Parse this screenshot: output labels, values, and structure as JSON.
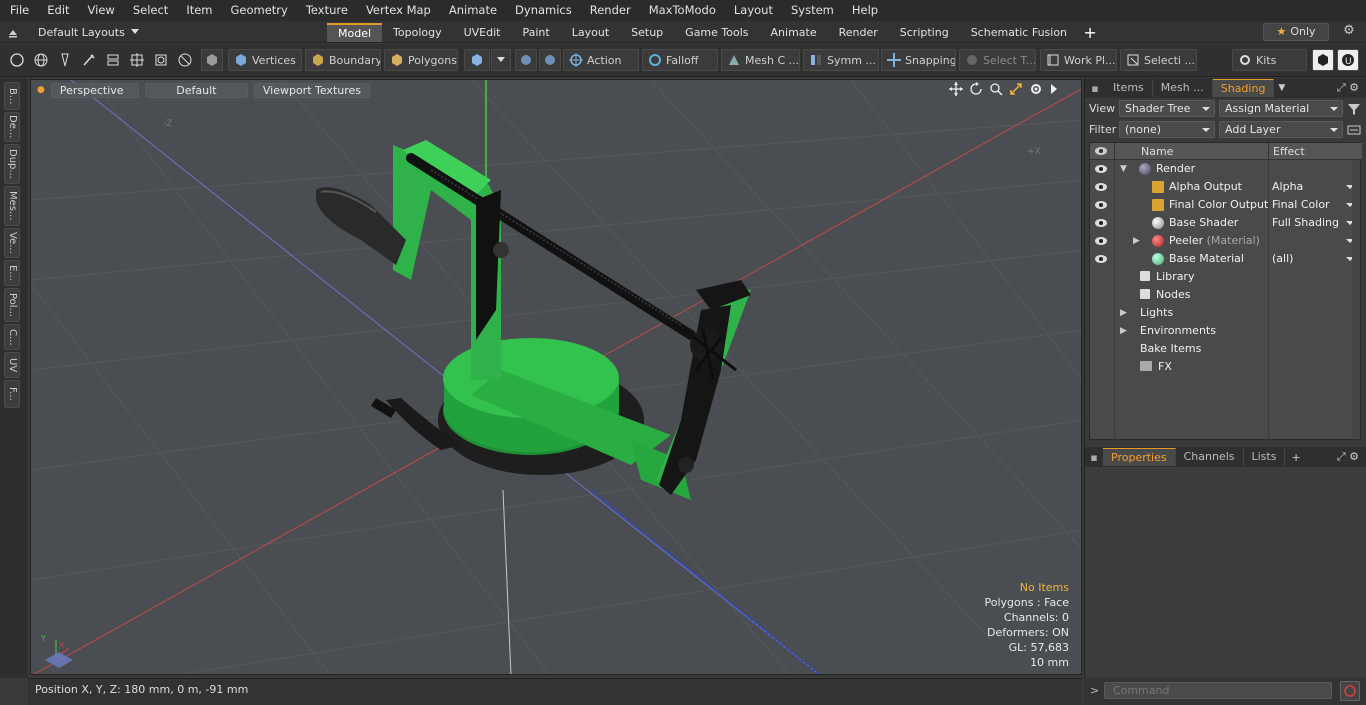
{
  "menubar": [
    "File",
    "Edit",
    "View",
    "Select",
    "Item",
    "Geometry",
    "Texture",
    "Vertex Map",
    "Animate",
    "Dynamics",
    "Render",
    "MaxToModo",
    "Layout",
    "System",
    "Help"
  ],
  "layouts": {
    "label": "Default Layouts"
  },
  "tabs": [
    "Model",
    "Topology",
    "UVEdit",
    "Paint",
    "Layout",
    "Setup",
    "Game Tools",
    "Animate",
    "Render",
    "Scripting",
    "Schematic Fusion"
  ],
  "active_tab": "Model",
  "only_button": "Only",
  "toolbar": {
    "vertices": "Vertices",
    "boundary": "Boundary",
    "polygons": "Polygons",
    "action": "Action",
    "falloff": "Falloff",
    "mesh": "Mesh C ...",
    "symm": "Symm ...",
    "snapping": "Snapping",
    "select_t": "Select T...",
    "work_pl": "Work Pl...",
    "selecti": "Selecti ...",
    "kits": "Kits"
  },
  "left_tabs": [
    "B...",
    "De...",
    "Dup...",
    "Mes...",
    "Ve...",
    "E...",
    "Pol...",
    "C...",
    "UV",
    "F..."
  ],
  "viewport": {
    "perspective": "Perspective",
    "default": "Default",
    "textures": "Viewport Textures",
    "info": {
      "no_items": "No Items",
      "polygons": "Polygons : Face",
      "channels": "Channels: 0",
      "deformers": "Deformers: ON",
      "gl": "GL: 57,683",
      "scale": "10 mm"
    },
    "axis_labels": {
      "z": "-Z",
      "x": "+X"
    }
  },
  "status": {
    "position": "Position X, Y, Z:  180 mm, 0 m, -91 mm"
  },
  "right_panel": {
    "tabs": [
      "Items",
      "Mesh ...",
      "Shading"
    ],
    "active_tab": "Shading",
    "view_label": "View",
    "view_value": "Shader Tree",
    "assign": "Assign Material",
    "filter_label": "Filter",
    "filter_value": "(none)",
    "add_layer": "Add Layer",
    "columns": {
      "name": "Name",
      "effect": "Effect"
    },
    "rows": [
      {
        "name": "Render",
        "effect": ""
      },
      {
        "name": "Alpha Output",
        "effect": "Alpha"
      },
      {
        "name": "Final Color Output",
        "effect": "Final Color"
      },
      {
        "name": "Base Shader",
        "effect": "Full Shading"
      },
      {
        "name": "Peeler",
        "suffix": "(Material)",
        "effect": ""
      },
      {
        "name": "Base Material",
        "effect": "(all)"
      },
      {
        "name": "Library",
        "effect": ""
      },
      {
        "name": "Nodes",
        "effect": ""
      },
      {
        "name": "Lights",
        "effect": ""
      },
      {
        "name": "Environments",
        "effect": ""
      },
      {
        "name": "Bake Items",
        "effect": ""
      },
      {
        "name": "FX",
        "effect": ""
      }
    ],
    "bottom_tabs": [
      "Properties",
      "Channels",
      "Lists"
    ],
    "bottom_active": "Properties",
    "command_placeholder": "Command"
  },
  "colors": {
    "accent": "#e39a2c",
    "model_green": "#2fb24a",
    "viewport_bg": "#4a4d52"
  }
}
